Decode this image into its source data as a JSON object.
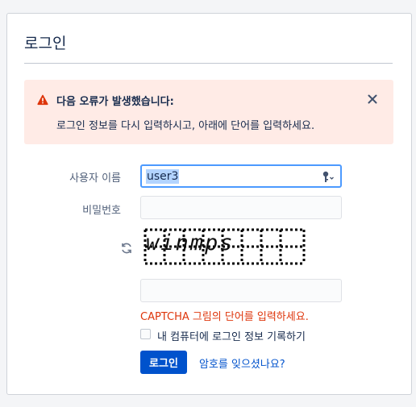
{
  "page": {
    "title": "로그인"
  },
  "alert": {
    "title": "다음 오류가 발생했습니다:",
    "message": "로그인 정보를 다시 입력하시고, 아래에 단어를 입력하세요.",
    "icon": "error-icon",
    "close_icon": "close-icon",
    "color_bg": "#ffebe6",
    "color_icon": "#de350b"
  },
  "form": {
    "username_label": "사용자 이름",
    "username_value": "user3",
    "password_label": "비밀번호",
    "password_value": "",
    "captcha_text": "winmps",
    "captcha_answer": "",
    "captcha_error": "CAPTCHA 그림의 단어를 입력하세요.",
    "remember_label": "내 컴퓨터에 로그인 정보 기록하기",
    "remember_checked": false,
    "login_button": "로그인",
    "forgot_link": "암호를 잊으셨나요?"
  },
  "colors": {
    "primary": "#0052cc",
    "error": "#de350b",
    "focus": "#4c9aff"
  }
}
